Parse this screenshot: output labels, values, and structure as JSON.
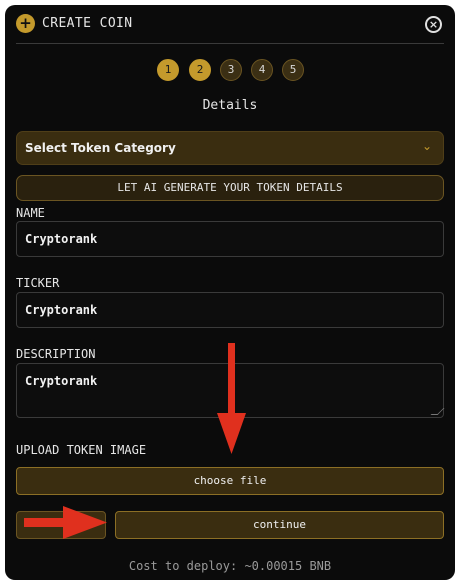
{
  "header": {
    "title": "CREATE COIN",
    "plus_icon": "plus-circle-icon",
    "close_icon": "close-circle-icon",
    "plus_glyph": "+",
    "close_glyph": "×"
  },
  "steps": [
    {
      "label": "1",
      "state": "active"
    },
    {
      "label": "2",
      "state": "active"
    },
    {
      "label": "3",
      "state": "inactive"
    },
    {
      "label": "4",
      "state": "inactive"
    },
    {
      "label": "5",
      "state": "inactive"
    }
  ],
  "section_title": "Details",
  "category_select": {
    "selected": "Select Token Category",
    "chevron_icon": "chevron-down-icon",
    "chevron_glyph": "⌄"
  },
  "ai_button": "LET AI GENERATE YOUR TOKEN DETAILS",
  "form": {
    "name_label": "NAME",
    "name_value": "Cryptorank",
    "ticker_label": "TICKER",
    "ticker_value": "Cryptorank",
    "description_label": "DESCRIPTION",
    "description_value": "Cryptorank",
    "upload_label": "UPLOAD TOKEN IMAGE",
    "choose_file": "choose file"
  },
  "actions": {
    "back_label": "",
    "continue_label": "continue"
  },
  "cost_text": "Cost to deploy: ~0.00015 BNB",
  "colors": {
    "accent_gold": "#c49a2c",
    "button_bg": "#3a2d10",
    "modal_bg": "#0b0b0b",
    "annotation_arrow": "#e0301e"
  }
}
